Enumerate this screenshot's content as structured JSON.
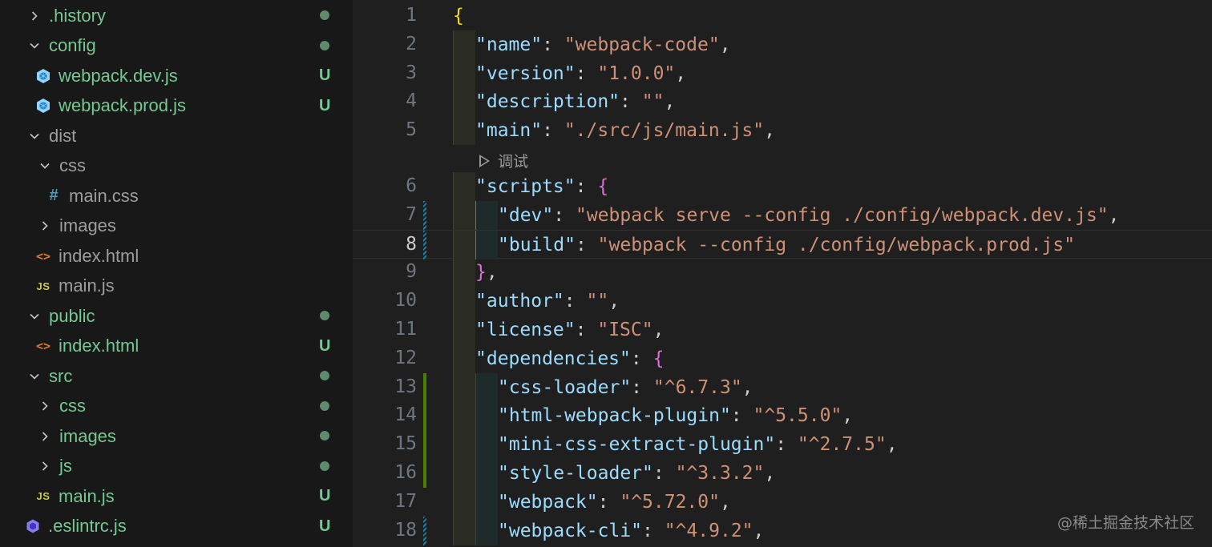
{
  "explorer": {
    "items": [
      {
        "label": ".history",
        "kind": "folder",
        "expanded": false,
        "depth": 0,
        "color": "green",
        "status": "dot"
      },
      {
        "label": "config",
        "kind": "folder",
        "expanded": true,
        "depth": 0,
        "color": "green",
        "status": "dot"
      },
      {
        "label": "webpack.dev.js",
        "kind": "webpack",
        "depth": 1,
        "color": "green",
        "status": "U"
      },
      {
        "label": "webpack.prod.js",
        "kind": "webpack",
        "depth": 1,
        "color": "green",
        "status": "U"
      },
      {
        "label": "dist",
        "kind": "folder",
        "expanded": true,
        "depth": 0,
        "color": "gray",
        "status": ""
      },
      {
        "label": "css",
        "kind": "folder",
        "expanded": true,
        "depth": 1,
        "color": "gray",
        "status": ""
      },
      {
        "label": "main.css",
        "kind": "css",
        "depth": 2,
        "color": "gray",
        "status": ""
      },
      {
        "label": "images",
        "kind": "folder",
        "expanded": false,
        "depth": 1,
        "color": "gray",
        "status": ""
      },
      {
        "label": "index.html",
        "kind": "html",
        "depth": 1,
        "color": "gray",
        "status": ""
      },
      {
        "label": "main.js",
        "kind": "js",
        "depth": 1,
        "color": "gray",
        "status": ""
      },
      {
        "label": "public",
        "kind": "folder",
        "expanded": true,
        "depth": 0,
        "color": "green",
        "status": "dot"
      },
      {
        "label": "index.html",
        "kind": "html",
        "depth": 1,
        "color": "green",
        "status": "U"
      },
      {
        "label": "src",
        "kind": "folder",
        "expanded": true,
        "depth": 0,
        "color": "green",
        "status": "dot"
      },
      {
        "label": "css",
        "kind": "folder",
        "expanded": false,
        "depth": 1,
        "color": "green",
        "status": "dot"
      },
      {
        "label": "images",
        "kind": "folder",
        "expanded": false,
        "depth": 1,
        "color": "green",
        "status": "dot"
      },
      {
        "label": "js",
        "kind": "folder",
        "expanded": false,
        "depth": 1,
        "color": "green",
        "status": "dot"
      },
      {
        "label": "main.js",
        "kind": "js",
        "depth": 1,
        "color": "green",
        "status": "U"
      },
      {
        "label": ".eslintrc.js",
        "kind": "eslint",
        "depth": 0,
        "color": "green",
        "status": "U"
      }
    ]
  },
  "editor": {
    "codelens_label": "调试",
    "current_line": 8,
    "lines": [
      {
        "n": "1",
        "text": "{"
      },
      {
        "n": "2",
        "text": "\"name\": \"webpack-code\","
      },
      {
        "n": "3",
        "text": "\"version\": \"1.0.0\","
      },
      {
        "n": "4",
        "text": "\"description\": \"\","
      },
      {
        "n": "5",
        "text": "\"main\": \"./src/js/main.js\","
      },
      {
        "n": "6",
        "text": "\"scripts\": {"
      },
      {
        "n": "7",
        "text": "\"dev\": \"webpack serve --config ./config/webpack.dev.js\","
      },
      {
        "n": "8",
        "text": "\"build\": \"webpack --config ./config/webpack.prod.js\""
      },
      {
        "n": "9",
        "text": "},"
      },
      {
        "n": "10",
        "text": "\"author\": \"\","
      },
      {
        "n": "11",
        "text": "\"license\": \"ISC\","
      },
      {
        "n": "12",
        "text": "\"dependencies\": {"
      },
      {
        "n": "13",
        "text": "\"css-loader\": \"^6.7.3\","
      },
      {
        "n": "14",
        "text": "\"html-webpack-plugin\": \"^5.5.0\","
      },
      {
        "n": "15",
        "text": "\"mini-css-extract-plugin\": \"^2.7.5\","
      },
      {
        "n": "16",
        "text": "\"style-loader\": \"^3.3.2\","
      },
      {
        "n": "17",
        "text": "\"webpack\": \"^5.72.0\","
      },
      {
        "n": "18",
        "text": "\"webpack-cli\": \"^4.9.2\","
      }
    ]
  },
  "watermark": "@稀土掘金技术社区"
}
